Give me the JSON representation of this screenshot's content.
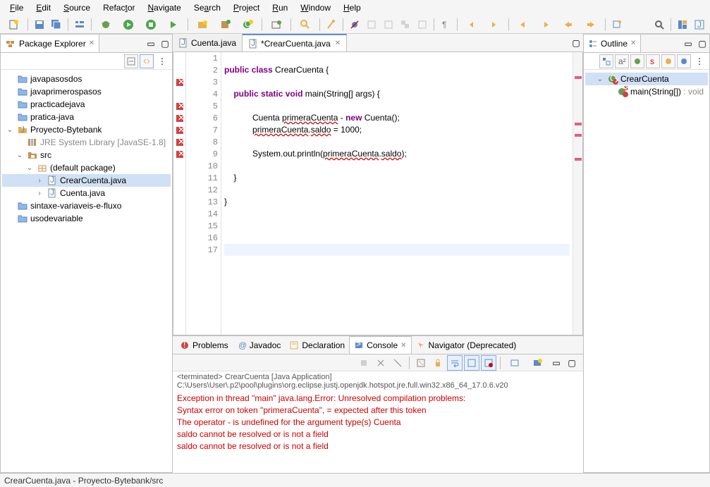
{
  "menu": {
    "file": "File",
    "edit": "Edit",
    "source": "Source",
    "refactor": "Refactor",
    "navigate": "Navigate",
    "search": "Search",
    "project": "Project",
    "run": "Run",
    "window": "Window",
    "help": "Help"
  },
  "package_explorer": {
    "title": "Package Explorer",
    "items": [
      {
        "label": "javapasosdos",
        "icon": "folder",
        "level": 1
      },
      {
        "label": "javaprimerospasos",
        "icon": "folder",
        "level": 1
      },
      {
        "label": "practicadejava",
        "icon": "folder",
        "level": 1
      },
      {
        "label": "pratica-java",
        "icon": "folder",
        "level": 1
      },
      {
        "label": "Proyecto-Bytebank",
        "icon": "project",
        "level": 1,
        "exp": "open"
      },
      {
        "label": "JRE System Library [JavaSE-1.8]",
        "icon": "lib",
        "level": 2,
        "lib": true
      },
      {
        "label": "src",
        "icon": "packfolder",
        "level": 2,
        "exp": "open"
      },
      {
        "label": "(default package)",
        "icon": "package",
        "level": 3,
        "exp": "open"
      },
      {
        "label": "CrearCuenta.java",
        "icon": "javafile",
        "level": 4,
        "exp": "closed",
        "selected": true
      },
      {
        "label": "Cuenta.java",
        "icon": "javafile",
        "level": 4,
        "exp": "closed"
      },
      {
        "label": "sintaxe-variaveis-e-fluxo",
        "icon": "folder",
        "level": 1
      },
      {
        "label": "usodevariable",
        "icon": "folder",
        "level": 1
      }
    ]
  },
  "editor_tabs": [
    {
      "label": "Cuenta.java",
      "active": false
    },
    {
      "label": "*CrearCuenta.java",
      "active": true
    }
  ],
  "code_lines": [
    "",
    "public class CrearCuenta {",
    "",
    "    public static void main(String[] args) {",
    "",
    "            Cuenta primeraCuenta - new Cuenta();",
    "            primeraCuenta.saldo = 1000;",
    "",
    "            System.out.println(primeraCuenta.saldo);",
    "",
    "    }",
    "",
    "}",
    "",
    "",
    "",
    ""
  ],
  "error_lines": [
    3,
    5,
    6,
    7,
    8,
    9
  ],
  "outline": {
    "title": "Outline",
    "items": [
      {
        "label": "CrearCuenta",
        "selected": true,
        "level": 1,
        "exp": "open",
        "icon": "class-err"
      },
      {
        "label": "main(String[]) : void",
        "level": 2,
        "icon": "method-err"
      }
    ]
  },
  "bottom_tabs": [
    {
      "label": "Problems",
      "icon": "problems"
    },
    {
      "label": "Javadoc",
      "icon": "javadoc"
    },
    {
      "label": "Declaration",
      "icon": "declaration"
    },
    {
      "label": "Console",
      "icon": "console",
      "active": true,
      "closable": true
    },
    {
      "label": "Navigator (Deprecated)",
      "icon": "navigator"
    }
  ],
  "console": {
    "header": "<terminated> CrearCuenta [Java Application] C:\\Users\\User\\.p2\\pool\\plugins\\org.eclipse.justj.openjdk.hotspot.jre.full.win32.x86_64_17.0.6.v20",
    "lines": [
      "Exception in thread \"main\" java.lang.Error: Unresolved compilation problems:",
      "\tSyntax error on token \"primeraCuenta\", = expected after this token",
      "\tThe operator - is undefined for the argument type(s) Cuenta",
      "\tsaldo cannot be resolved or is not a field",
      "\tsaldo cannot be resolved or is not a field"
    ]
  },
  "statusbar": "CrearCuenta.java - Proyecto-Bytebank/src"
}
